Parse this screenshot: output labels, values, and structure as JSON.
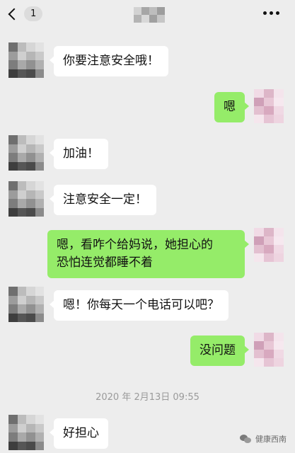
{
  "header": {
    "unread_count": "1",
    "title_redacted": true
  },
  "messages": [
    {
      "side": "in",
      "text": "你要注意安全哦！"
    },
    {
      "side": "out",
      "text": "嗯"
    },
    {
      "side": "in",
      "text": "加油！"
    },
    {
      "side": "in",
      "text": "注意安全一定！"
    },
    {
      "side": "out",
      "lines": [
        "嗯，看咋个给妈说，她担心的",
        "恐怕连觉都睡不着"
      ]
    },
    {
      "side": "in",
      "text": "嗯！你每天一个电话可以吧？"
    },
    {
      "side": "out",
      "text": "没问题"
    },
    {
      "side": "in",
      "text": "好担心"
    }
  ],
  "timestamp": "2020 年 2月13日 09:55",
  "watermark": "健康西南",
  "colors": {
    "background": "#ededed",
    "incoming_bubble": "#ffffff",
    "outgoing_bubble": "#95ec69",
    "timestamp_text": "#9a9a9a"
  },
  "icons": {
    "back": "chevron-left-icon",
    "more": "more-dots-icon",
    "watermark": "wechat-icon"
  }
}
